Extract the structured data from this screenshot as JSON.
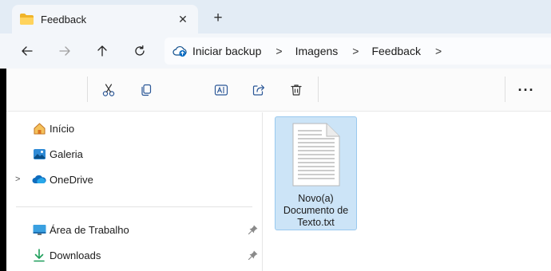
{
  "tab": {
    "title": "Feedback",
    "close_glyph": "✕",
    "new_tab_glyph": "+"
  },
  "nav": {
    "back_icon": "arrow-left-icon",
    "forward_icon": "arrow-right-icon",
    "up_icon": "arrow-up-icon",
    "refresh_icon": "refresh-icon"
  },
  "breadcrumb": {
    "items": [
      "Iniciar backup",
      "Imagens",
      "Feedback"
    ],
    "separator": ">"
  },
  "commands": {
    "icons": [
      "cut-icon",
      "copy-icon",
      "rename-icon",
      "share-icon",
      "delete-icon"
    ],
    "more_label": "···"
  },
  "sidebar": {
    "items": [
      {
        "label": "Início",
        "icon": "home-icon"
      },
      {
        "label": "Galeria",
        "icon": "gallery-icon"
      },
      {
        "label": "OneDrive",
        "icon": "onedrive-icon",
        "expandable": true
      },
      {
        "label": "Área de Trabalho",
        "icon": "desktop-icon",
        "pinned": true
      },
      {
        "label": "Downloads",
        "icon": "downloads-icon",
        "pinned": true
      }
    ]
  },
  "files": [
    {
      "name": "Novo(a) Documento de Texto.txt",
      "selected": true,
      "icon": "text-document-icon"
    }
  ],
  "colors": {
    "accent": "#0067c0",
    "selection_bg": "#cce4f7",
    "selection_border": "#99c9ef",
    "tabstrip_bg": "#e3ecf5"
  }
}
